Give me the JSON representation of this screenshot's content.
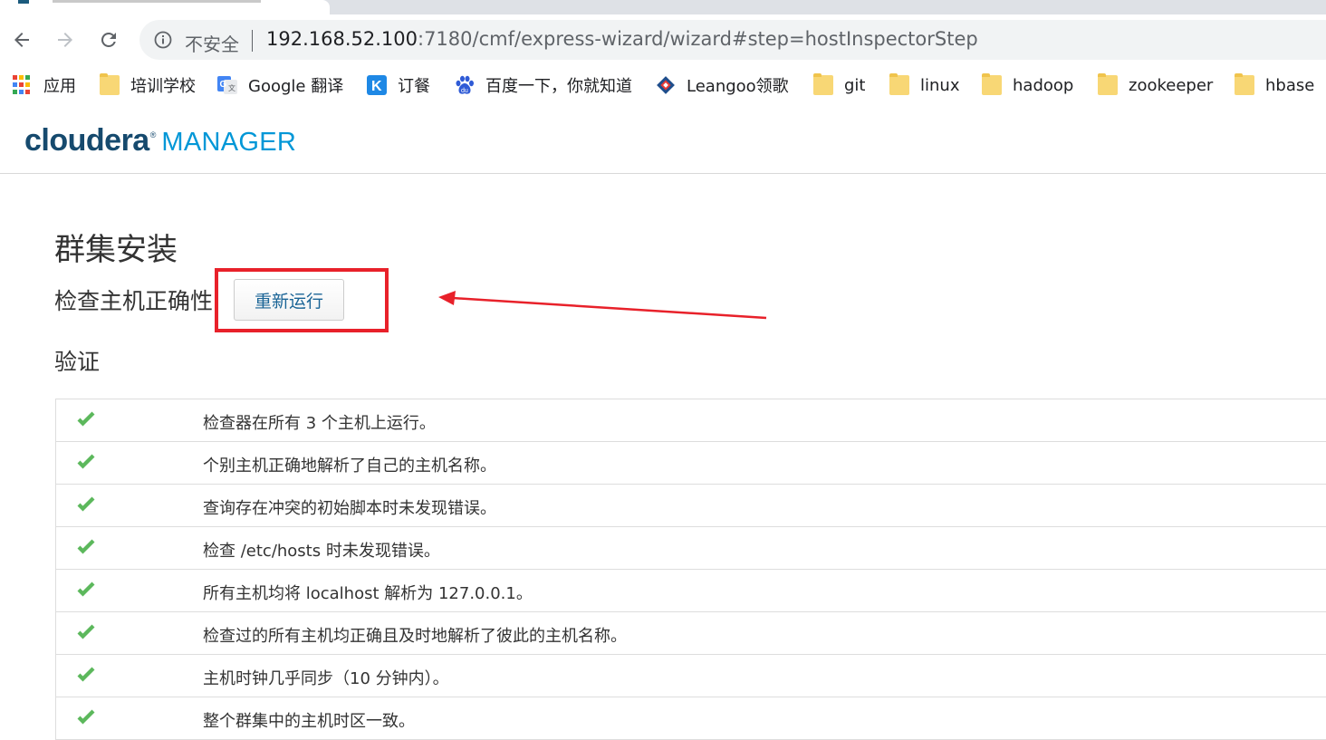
{
  "browser": {
    "security_label": "不安全",
    "url_host": "192.168.52.100",
    "url_rest": ":7180/cmf/express-wizard/wizard#step=hostInspectorStep",
    "bookmarks": [
      {
        "label": "应用",
        "icon": "apps-grid-icon"
      },
      {
        "label": "培训学校",
        "icon": "folder-icon"
      },
      {
        "label": "Google 翻译",
        "icon": "google-translate-icon"
      },
      {
        "label": "订餐",
        "icon": "k-icon"
      },
      {
        "label": "百度一下，你就知道",
        "icon": "baidu-icon"
      },
      {
        "label": "Leangoo领歌",
        "icon": "leangoo-icon"
      },
      {
        "label": "git",
        "icon": "folder-icon"
      },
      {
        "label": "linux",
        "icon": "folder-icon"
      },
      {
        "label": "hadoop",
        "icon": "folder-icon"
      },
      {
        "label": "zookeeper",
        "icon": "folder-icon"
      },
      {
        "label": "hbase",
        "icon": "folder-icon"
      }
    ]
  },
  "header": {
    "logo_primary": "cloudera",
    "logo_secondary": "MANAGER"
  },
  "main": {
    "title": "群集安装",
    "step_title": "检查主机正确性",
    "rerun_label": "重新运行",
    "section_title": "验证",
    "checks": [
      "检查器在所有 3 个主机上运行。",
      "个别主机正确地解析了自己的主机名称。",
      "查询存在冲突的初始脚本时未发现错误。",
      "检查 /etc/hosts 时未发现错误。",
      "所有主机均将 localhost 解析为 127.0.0.1。",
      "检查过的所有主机均正确且及时地解析了彼此的主机名称。",
      "主机时钟几乎同步（10 分钟内）。",
      "整个群集中的主机时区一致。"
    ]
  },
  "colors": {
    "accent": "#0097d7",
    "brand": "#164a6e",
    "success": "#5cb85c",
    "annotation": "#e8212a"
  }
}
